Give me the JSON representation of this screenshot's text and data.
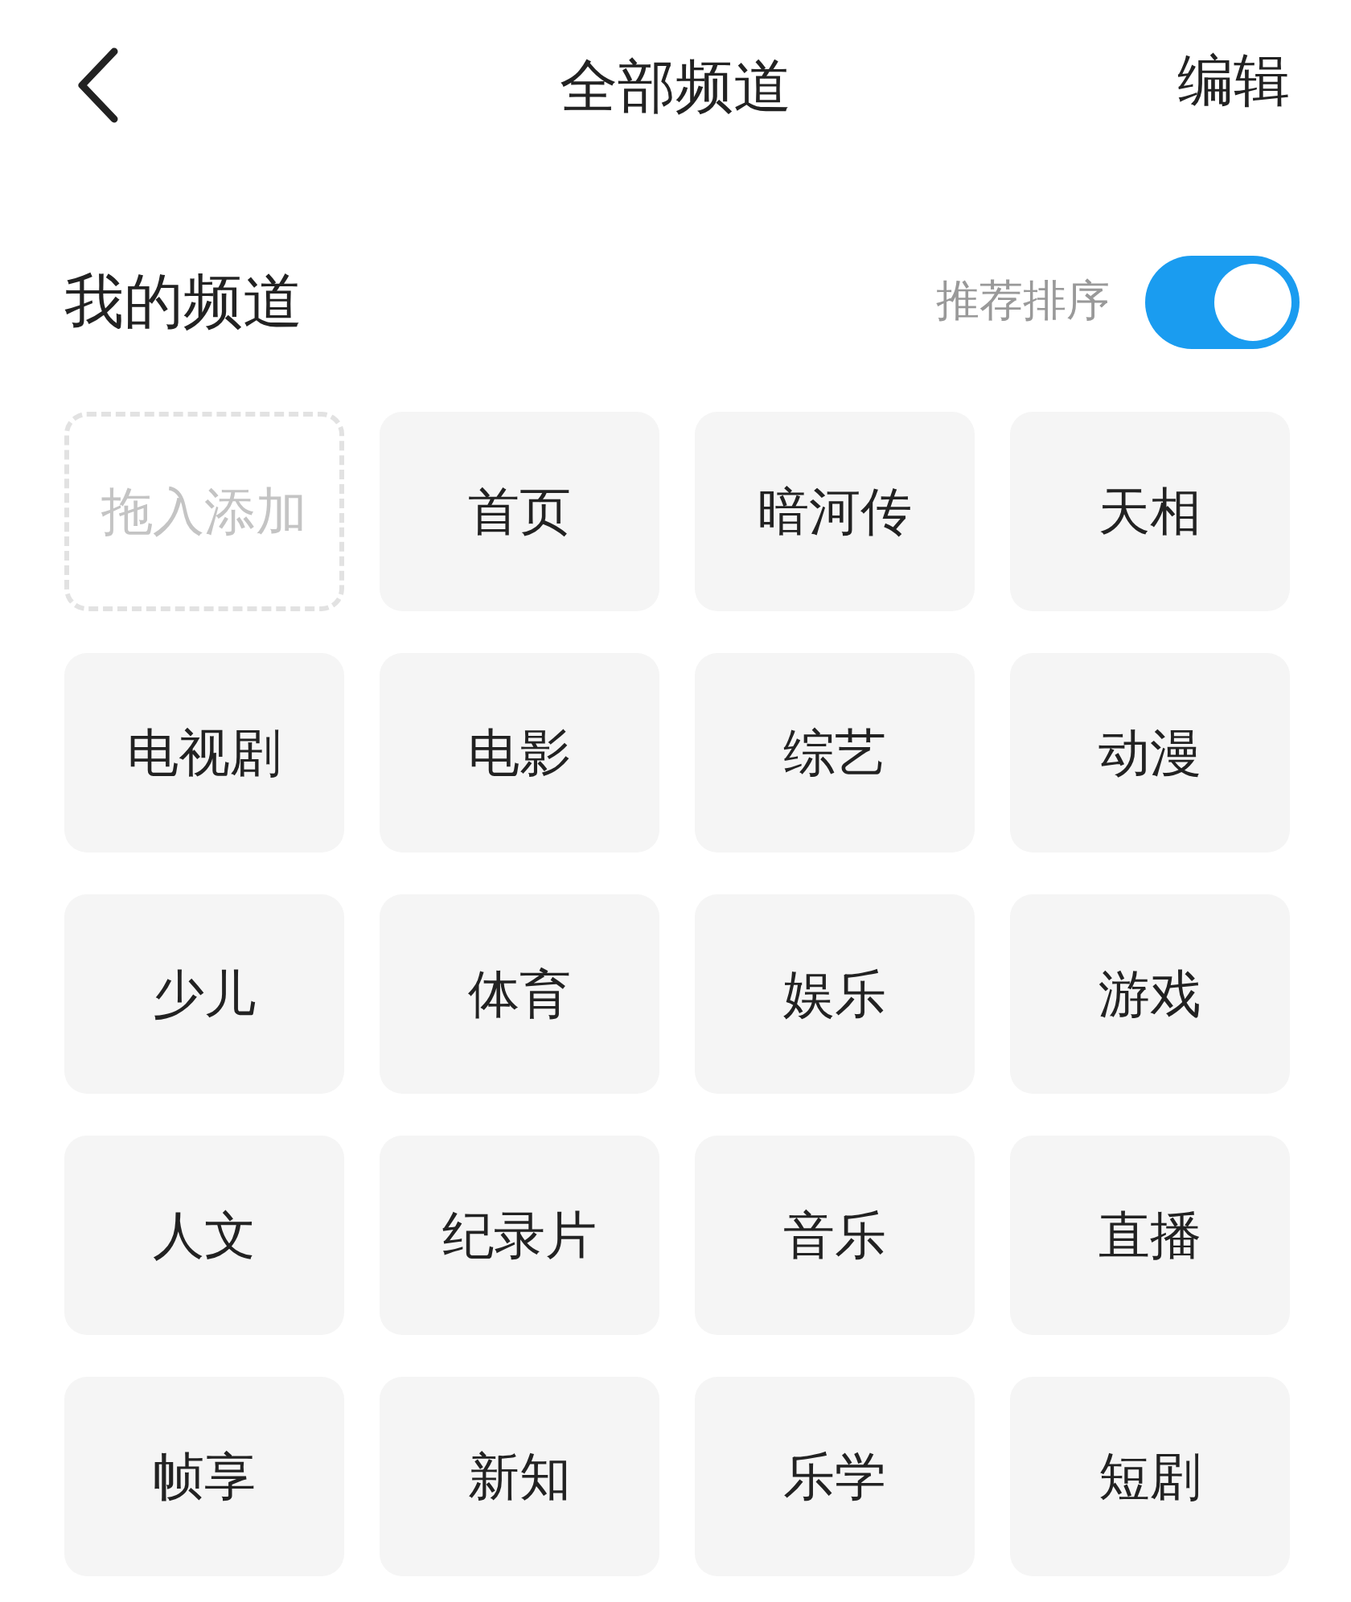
{
  "header": {
    "title": "全部频道",
    "action": "编辑"
  },
  "section": {
    "title": "我的频道",
    "sort_label": "推荐排序",
    "sort_toggle": {
      "on": true
    }
  },
  "channels": [
    {
      "label": "拖入添加",
      "kind": "drop"
    },
    {
      "label": "首页",
      "kind": "channel"
    },
    {
      "label": "暗河传",
      "kind": "channel"
    },
    {
      "label": "天相",
      "kind": "channel"
    },
    {
      "label": "电视剧",
      "kind": "channel"
    },
    {
      "label": "电影",
      "kind": "channel"
    },
    {
      "label": "综艺",
      "kind": "channel"
    },
    {
      "label": "动漫",
      "kind": "channel"
    },
    {
      "label": "少儿",
      "kind": "channel"
    },
    {
      "label": "体育",
      "kind": "channel"
    },
    {
      "label": "娱乐",
      "kind": "channel"
    },
    {
      "label": "游戏",
      "kind": "channel"
    },
    {
      "label": "人文",
      "kind": "channel"
    },
    {
      "label": "纪录片",
      "kind": "channel"
    },
    {
      "label": "音乐",
      "kind": "channel"
    },
    {
      "label": "直播",
      "kind": "channel"
    },
    {
      "label": "帧享",
      "kind": "channel"
    },
    {
      "label": "新知",
      "kind": "channel"
    },
    {
      "label": "乐学",
      "kind": "channel"
    },
    {
      "label": "短剧",
      "kind": "channel"
    }
  ]
}
